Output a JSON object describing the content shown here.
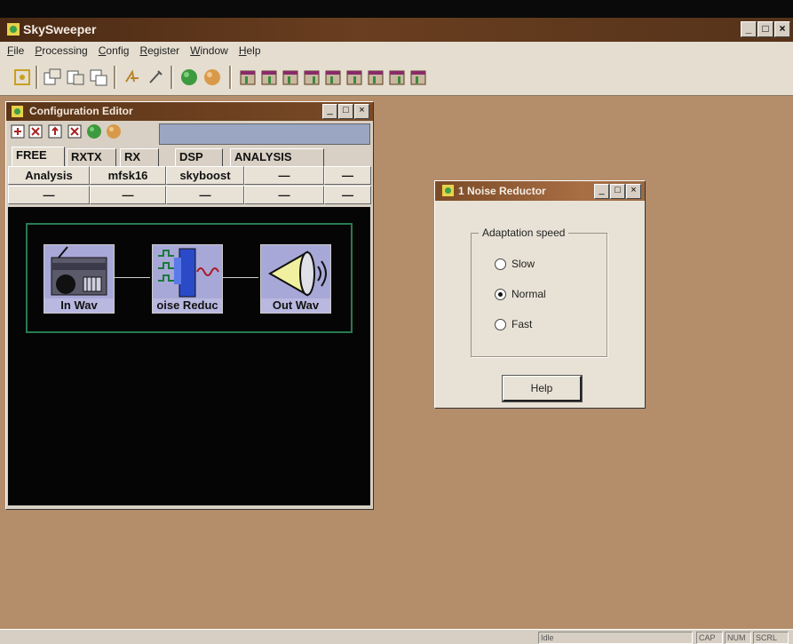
{
  "app": {
    "title": "SkySweeper",
    "window_buttons": [
      "_",
      "□",
      "×"
    ]
  },
  "menu": [
    "File",
    "Processing",
    "Config",
    "Register",
    "Window",
    "Help"
  ],
  "toolbar": {
    "icons": [
      "new-config-icon",
      "open-icon",
      "save-icon",
      "save-as-icon",
      "tune-icon",
      "tool-icon",
      "green-globe-icon",
      "orange-globe-icon",
      "module-1-icon",
      "module-2-icon",
      "module-3-icon",
      "module-4-icon",
      "module-5-icon",
      "module-6-icon",
      "module-7-icon",
      "module-8-icon"
    ]
  },
  "config_editor": {
    "title": "Configuration Editor",
    "window_buttons": [
      "_",
      "□",
      "×"
    ],
    "tabs": [
      "FREE",
      "RXTX",
      "RX",
      "DSP",
      "ANALYSIS"
    ],
    "active_tab": "FREE",
    "presets_row1": [
      "Analysis",
      "mfsk16",
      "skyboost",
      "—",
      "—"
    ],
    "presets_row2": [
      "—",
      "—",
      "—",
      "—",
      "—"
    ],
    "nodes": [
      {
        "label": "In Wav",
        "icon": "radio-icon"
      },
      {
        "label": "oise Reduc",
        "icon": "noise-filter-icon"
      },
      {
        "label": "Out Wav",
        "icon": "speaker-icon"
      }
    ]
  },
  "noise_dialog": {
    "title": "1 Noise Reductor",
    "window_buttons": [
      "_",
      "□",
      "×"
    ],
    "group_label": "Adaptation speed",
    "options": [
      "Slow",
      "Normal",
      "Fast"
    ],
    "selected": "Normal",
    "help_label": "Help"
  },
  "status": {
    "left": "Idle",
    "right": [
      "CAP",
      "NUM",
      "SCRL"
    ]
  },
  "colors": {
    "desktop": "#b48d6a",
    "titlebar": "#5a3418",
    "canvas": "#050505",
    "chain_border": "#2a7a52"
  }
}
